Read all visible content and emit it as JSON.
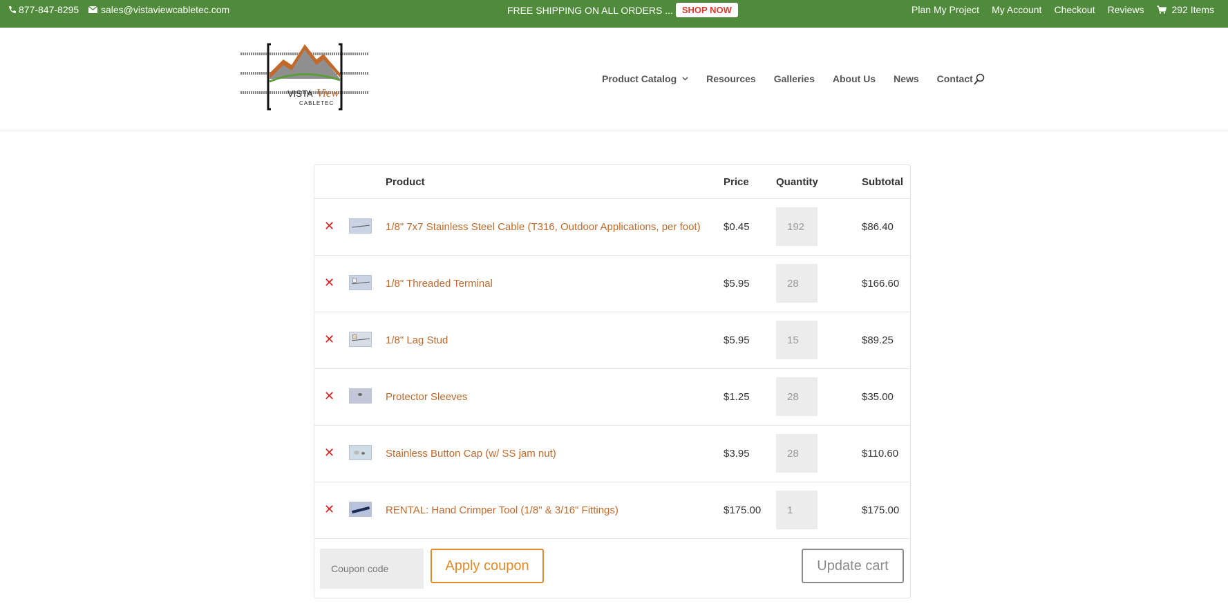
{
  "topbar": {
    "phone": "877-847-8295",
    "email": "sales@vistaviewcabletec.com",
    "promo_text": "FREE SHIPPING ON ALL ORDERS ...",
    "promo_button": "SHOP NOW",
    "links": [
      "Plan My Project",
      "My Account",
      "Checkout",
      "Reviews"
    ],
    "cart_count": "292 Items"
  },
  "logo": {
    "word1": "VISTA",
    "word2": "View",
    "word3": "CABLETEC"
  },
  "nav": {
    "items": [
      "Product Catalog",
      "Resources",
      "Galleries",
      "About Us",
      "News",
      "Contact"
    ]
  },
  "cart": {
    "headers": {
      "product": "Product",
      "price": "Price",
      "quantity": "Quantity",
      "subtotal": "Subtotal"
    },
    "rows": [
      {
        "name": "1/8\" 7x7 Stainless Steel Cable (T316, Outdoor Applications, per foot)",
        "price": "$0.45",
        "qty": "192",
        "subtotal": "$86.40"
      },
      {
        "name": "1/8\" Threaded Terminal",
        "price": "$5.95",
        "qty": "28",
        "subtotal": "$166.60"
      },
      {
        "name": "1/8\" Lag Stud",
        "price": "$5.95",
        "qty": "15",
        "subtotal": "$89.25"
      },
      {
        "name": "Protector Sleeves",
        "price": "$1.25",
        "qty": "28",
        "subtotal": "$35.00"
      },
      {
        "name": "Stainless Button Cap (w/ SS jam nut)",
        "price": "$3.95",
        "qty": "28",
        "subtotal": "$110.60"
      },
      {
        "name": "RENTAL: Hand Crimper Tool (1/8\" & 3/16\" Fittings)",
        "price": "$175.00",
        "qty": "1",
        "subtotal": "$175.00"
      }
    ],
    "remove_symbol": "✕",
    "coupon_placeholder": "Coupon code",
    "apply_label": "Apply coupon",
    "update_label": "Update cart"
  },
  "colors": {
    "topbar": "#4f8b3a",
    "link": "#c0692b",
    "accent": "#e08a2a",
    "remove": "#e01d1d"
  }
}
